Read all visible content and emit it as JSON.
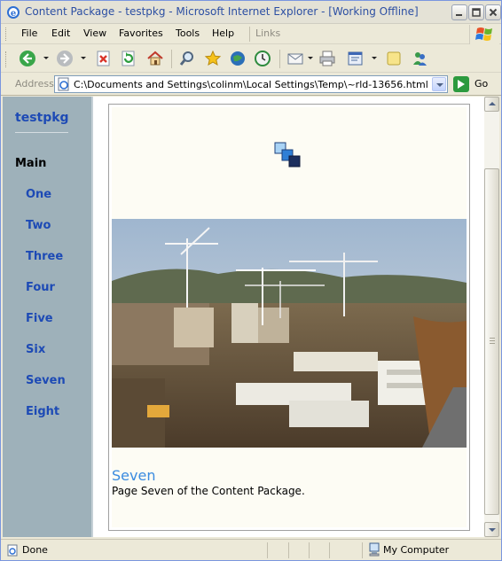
{
  "window": {
    "title": "Content Package - testpkg - Microsoft Internet Explorer - [Working Offline]"
  },
  "menu": [
    "File",
    "Edit",
    "View",
    "Favorites",
    "Tools",
    "Help"
  ],
  "links_label": "Links",
  "toolbar_icons": [
    "back-icon",
    "forward-icon",
    "stop-icon",
    "refresh-icon",
    "home-icon",
    "search-icon",
    "favorites-star-icon",
    "media-icon",
    "history-icon",
    "mail-icon",
    "print-icon",
    "edit-icon",
    "discuss-icon",
    "messenger-icon"
  ],
  "address": {
    "label": "Address",
    "value": "C:\\Documents and Settings\\colinm\\Local Settings\\Temp\\~rld-13656.html",
    "go": "Go"
  },
  "sidebar": {
    "title": "testpkg",
    "section": "Main",
    "items": [
      "One",
      "Two",
      "Three",
      "Four",
      "Five",
      "Six",
      "Seven",
      "Eight"
    ]
  },
  "page": {
    "heading": "Seven",
    "text": "Page Seven of the Content Package."
  },
  "status": {
    "text": "Done",
    "zone": "My Computer"
  },
  "colors": {
    "link": "#1d4ab5",
    "heading": "#3a8be0",
    "sidebar_bg": "#9eb1ba"
  }
}
